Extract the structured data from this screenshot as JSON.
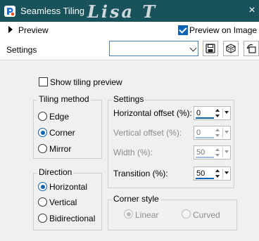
{
  "window": {
    "title": "Seamless Tiling",
    "watermark": "Lisa T",
    "close_glyph": "×"
  },
  "preview": {
    "label": "Preview",
    "preview_on_image_label": "Preview on Image",
    "preview_on_image_checked": true
  },
  "settings_bar": {
    "label": "Settings",
    "preset_value": ""
  },
  "options": {
    "show_tiling_preview_label": "Show tiling preview",
    "show_tiling_preview_checked": false
  },
  "tiling_method": {
    "title": "Tiling method",
    "options": [
      "Edge",
      "Corner",
      "Mirror"
    ],
    "selected": "Corner"
  },
  "direction": {
    "title": "Direction",
    "options": [
      "Horizontal",
      "Vertical",
      "Bidirectional"
    ],
    "selected": "Horizontal"
  },
  "settings": {
    "title": "Settings",
    "horizontal_offset": {
      "label": "Horizontal offset (%):",
      "value": "0",
      "enabled": true
    },
    "vertical_offset": {
      "label": "Vertical offset (%):",
      "value": "0",
      "enabled": false
    },
    "width": {
      "label": "Width (%):",
      "value": "50",
      "enabled": false
    },
    "transition": {
      "label": "Transition (%):",
      "value": "50",
      "enabled": true
    }
  },
  "corner_style": {
    "title": "Corner style",
    "options": [
      "Linear",
      "Curved"
    ],
    "selected": "Linear",
    "enabled": false
  },
  "colors": {
    "titlebar": "#18525a",
    "accent": "#0b63b4"
  }
}
